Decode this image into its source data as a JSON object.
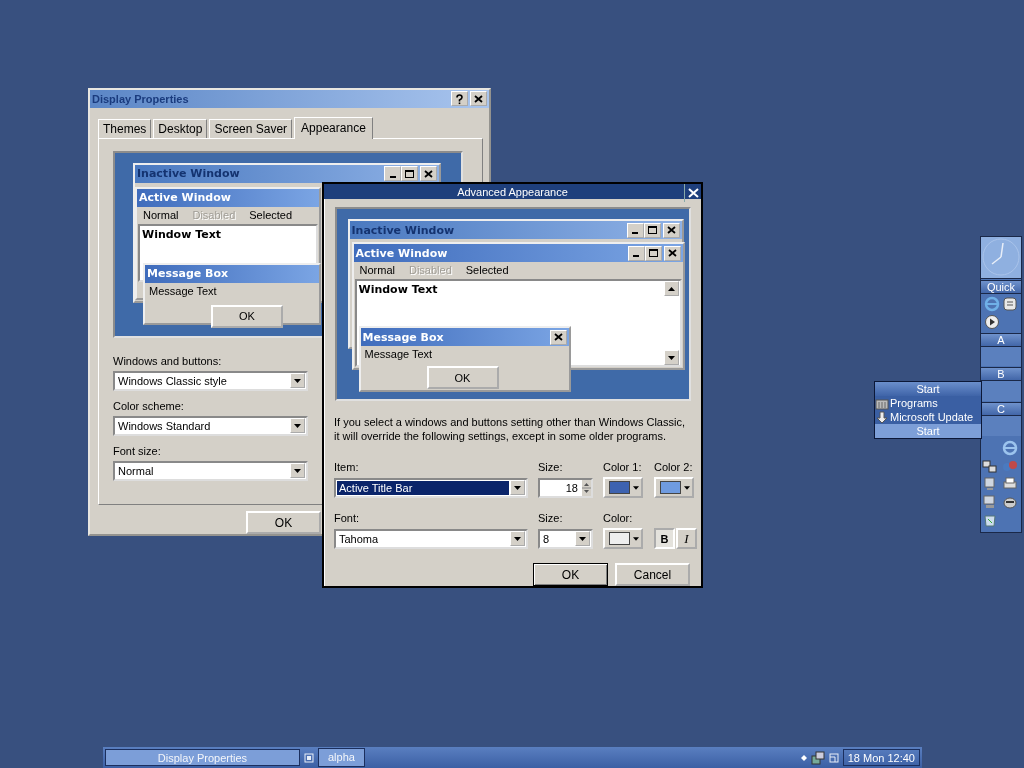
{
  "display_properties": {
    "title": "Display Properties",
    "tabs": [
      {
        "label": "Themes",
        "selected": false
      },
      {
        "label": "Desktop",
        "selected": false
      },
      {
        "label": "Screen Saver",
        "selected": false
      },
      {
        "label": "Appearance",
        "selected": true
      }
    ],
    "preview": {
      "inactive_title": "Inactive Window",
      "active_title": "Active Window",
      "menu": [
        {
          "label": "Normal",
          "disabled": false
        },
        {
          "label": "Disabled",
          "disabled": true
        },
        {
          "label": "Selected",
          "disabled": false
        }
      ],
      "window_text": "Window Text",
      "message_title": "Message Box",
      "message_text": "Message Text",
      "ok": "OK"
    },
    "fields": [
      {
        "label": "Windows and buttons:",
        "value": "Windows Classic style"
      },
      {
        "label": "Color scheme:",
        "value": "Windows Standard"
      },
      {
        "label": "Font size:",
        "value": "Normal"
      }
    ],
    "buttons": [
      "OK"
    ]
  },
  "advanced_appearance": {
    "title": "Advanced Appearance",
    "preview": {
      "inactive_title": "Inactive Window",
      "active_title": "Active Window",
      "menu": [
        {
          "label": "Normal",
          "disabled": false
        },
        {
          "label": "Disabled",
          "disabled": true
        },
        {
          "label": "Selected",
          "disabled": false
        }
      ],
      "window_text": "Window Text",
      "message_title": "Message Box",
      "message_text": "Message Text",
      "ok": "OK"
    },
    "note": "If you select a windows and buttons setting other than Windows Classic, it will override the following settings, except in some older programs.",
    "item": {
      "label": "Item:",
      "value": "Active Title Bar"
    },
    "item_size": {
      "label": "Size:",
      "value": "18"
    },
    "color_1": {
      "label": "Color 1:",
      "color": "#3d62b0"
    },
    "color_2": {
      "label": "Color 2:",
      "color": "#6f9be0"
    },
    "font": {
      "label": "Font:",
      "value": "Tahoma"
    },
    "font_size": {
      "label": "Size:",
      "value": "8"
    },
    "font_color": {
      "label": "Color:",
      "color": "#eeeeee"
    },
    "bold": {
      "label": "B",
      "on": true
    },
    "italic": {
      "label": "I",
      "on": false
    },
    "buttons": [
      "OK",
      "Cancel"
    ]
  },
  "side_bar": {
    "quick": "Quick",
    "sections": [
      "A",
      "B",
      "C"
    ]
  },
  "start_menu": {
    "title": "Start",
    "items": [
      "Programs",
      "Microsoft Update"
    ],
    "footer": "Start"
  },
  "taskbar": {
    "tasks": [
      "Display Properties",
      "alpha"
    ],
    "clock": "18 Mon 12:40"
  }
}
